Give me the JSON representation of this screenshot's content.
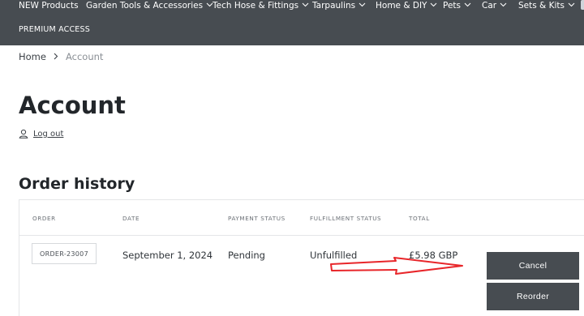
{
  "nav": {
    "items": [
      {
        "label": "NEW Products",
        "has_dropdown": false
      },
      {
        "label": "Garden Tools & Accessories",
        "has_dropdown": true
      },
      {
        "label": "Tech Hose & Fittings",
        "has_dropdown": true
      },
      {
        "label": "Tarpaulins",
        "has_dropdown": true
      },
      {
        "label": "Home & DIY",
        "has_dropdown": true
      },
      {
        "label": "Pets",
        "has_dropdown": true
      },
      {
        "label": "Car",
        "has_dropdown": true
      },
      {
        "label": "Sets & Kits",
        "has_dropdown": true
      }
    ],
    "premium": "PREMIUM ACCESS",
    "colors": {
      "background": "#474c51",
      "text": "#ffffff"
    }
  },
  "breadcrumb": {
    "home": "Home",
    "separator_icon": "chevron-right-icon",
    "current": "Account"
  },
  "account": {
    "title": "Account",
    "logout_icon": "user-icon",
    "logout_label": "Log out"
  },
  "orders": {
    "title": "Order history",
    "headers": {
      "order": "ORDER",
      "date": "DATE",
      "payment_status": "PAYMENT STATUS",
      "fulfillment_status": "FULFILLMENT STATUS",
      "total": "TOTAL"
    },
    "rows": [
      {
        "order": "ORDER-23007",
        "date": "September 1, 2024",
        "payment_status": "Pending",
        "fulfillment_status": "Unfulfilled",
        "total": "£5.98 GBP",
        "actions": {
          "cancel": "Cancel",
          "reorder": "Reorder"
        }
      }
    ]
  },
  "annotation": {
    "icon": "red-arrow-icon",
    "color": "#e8262a"
  },
  "colors": {
    "button": "#474c51",
    "border": "#e4e6e8",
    "muted_text": "#8a8f95"
  }
}
